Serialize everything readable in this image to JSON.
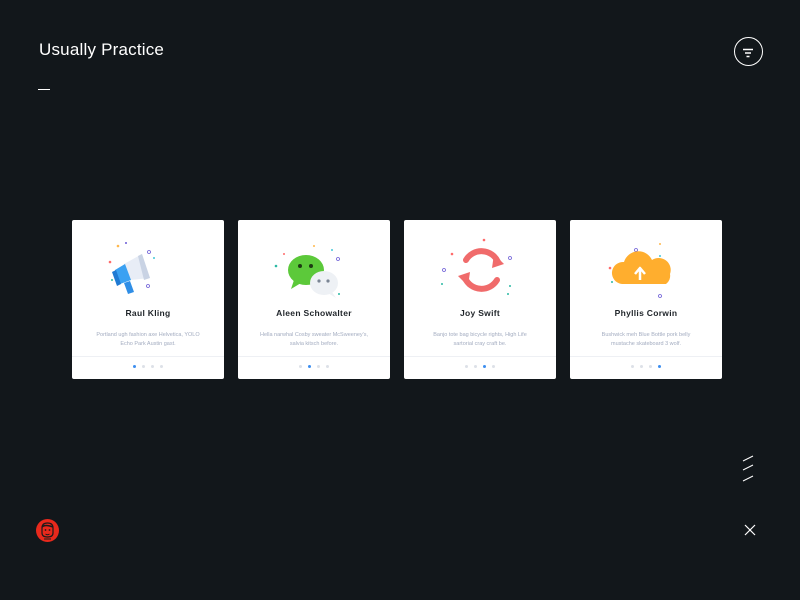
{
  "header": {
    "title": "Usually Practice",
    "menu_icon": "filter-menu-icon"
  },
  "cards": [
    {
      "name": "Raul Kling",
      "description": "Portland ugh fashion axe Helvetica, YOLO Echo Park Austin gast.",
      "icon": "megaphone-icon",
      "active_dot": 0
    },
    {
      "name": "Aleen Schowalter",
      "description": "Hella narwhal Cosby sweater McSweeney's, salvia kitsch before.",
      "icon": "chat-bubbles-icon",
      "active_dot": 1
    },
    {
      "name": "Joy Swift",
      "description": "Banjo tote bag bicycle rights, High Life sartorial cray craft be.",
      "icon": "refresh-arrows-icon",
      "active_dot": 2
    },
    {
      "name": "Phyllis Corwin",
      "description": "Bushwick meh Blue Bottle pork belly mustache skateboard 3 wolf.",
      "icon": "cloud-upload-icon",
      "active_dot": 3
    }
  ],
  "footer": {
    "avatar_icon": "avatar-face-icon",
    "slashes_icon": "slashes-icon",
    "close_icon": "close-icon"
  },
  "colors": {
    "background": "#12171b",
    "card": "#ffffff",
    "accent_dot": "#3d8ef0",
    "avatar": "#e8291c"
  }
}
